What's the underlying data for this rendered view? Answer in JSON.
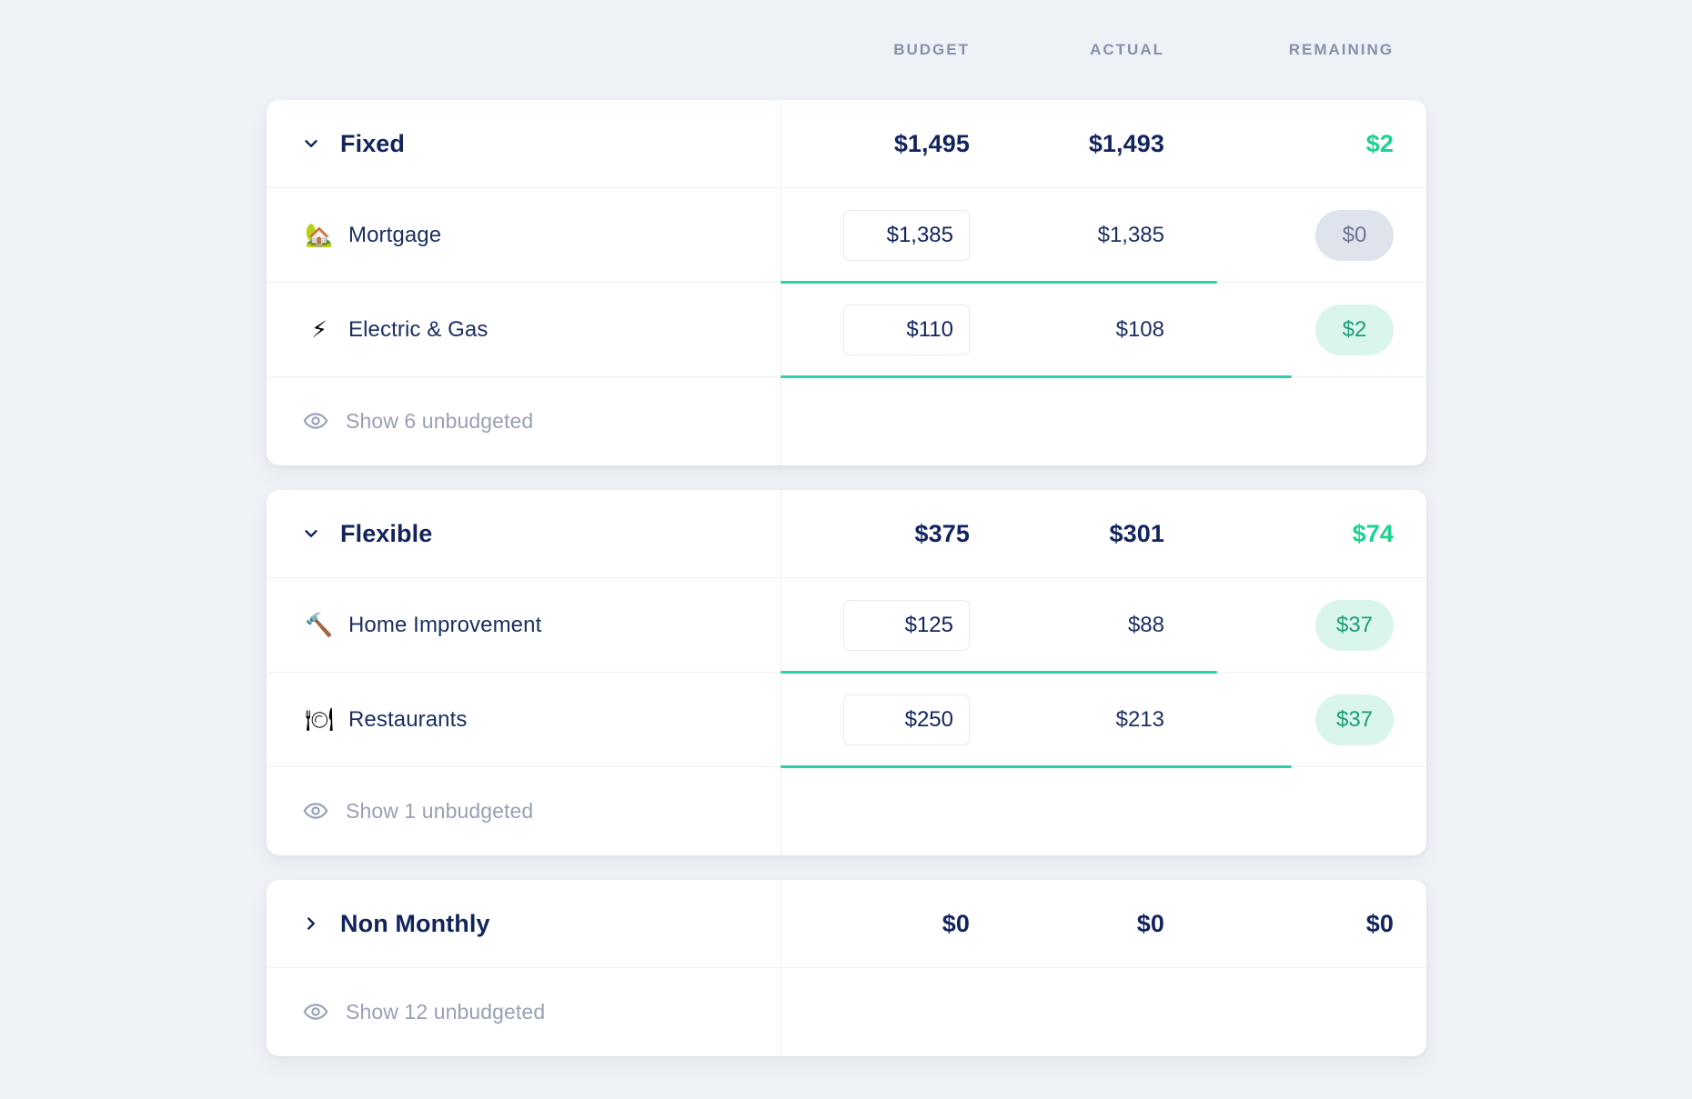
{
  "columns": {
    "budget": "BUDGET",
    "actual": "ACTUAL",
    "remaining": "REMAINING"
  },
  "colors": {
    "page_background": "#eef1f6",
    "card_background": "#ffffff",
    "text_navy": "#12245e",
    "text_muted": "#8791a8",
    "accent_green": "#19d48f",
    "progress_green": "#2fd0a5",
    "pill_zero_bg": "#dfe3ec",
    "pill_zero_text": "#6b7690",
    "pill_green_bg": "#d9f5ec",
    "pill_green_text": "#1c9d78"
  },
  "groups": [
    {
      "id": "fixed",
      "name": "Fixed",
      "expanded": true,
      "chevron": "chevron-down-icon",
      "budget": "$1,495",
      "actual": "$1,493",
      "remaining": "$2",
      "remaining_positive": true,
      "categories": [
        {
          "name": "Mortgage",
          "emoji": "🏡",
          "icon_name": "house-with-garden-emoji",
          "budget": "$1,385",
          "actual": "$1,385",
          "remaining": "$0",
          "pill_style": "zero",
          "progress_percent": 100
        },
        {
          "name": "Electric & Gas",
          "emoji": "⚡",
          "icon_name": "high-voltage-emoji",
          "budget": "$110",
          "actual": "$108",
          "remaining": "$2",
          "pill_style": "green",
          "progress_percent": 98
        }
      ],
      "show_unbudgeted": "Show 6 unbudgeted",
      "unbudgeted_count": 6
    },
    {
      "id": "flexible",
      "name": "Flexible",
      "expanded": true,
      "chevron": "chevron-down-icon",
      "budget": "$375",
      "actual": "$301",
      "remaining": "$74",
      "remaining_positive": true,
      "categories": [
        {
          "name": "Home Improvement",
          "emoji": "🔨",
          "icon_name": "hammer-emoji",
          "budget": "$125",
          "actual": "$88",
          "remaining": "$37",
          "pill_style": "green",
          "progress_percent": 70
        },
        {
          "name": "Restaurants",
          "emoji": "🍽",
          "icon_name": "fork-and-knife-with-plate-emoji",
          "budget": "$250",
          "actual": "$213",
          "remaining": "$37",
          "pill_style": "green",
          "progress_percent": 98
        }
      ],
      "show_unbudgeted": "Show 1 unbudgeted",
      "unbudgeted_count": 1
    },
    {
      "id": "non-monthly",
      "name": "Non Monthly",
      "expanded": false,
      "chevron": "chevron-right-icon",
      "budget": "$0",
      "actual": "$0",
      "remaining": "$0",
      "remaining_positive": false,
      "categories": [],
      "show_unbudgeted": "Show 12 unbudgeted",
      "unbudgeted_count": 12
    }
  ]
}
